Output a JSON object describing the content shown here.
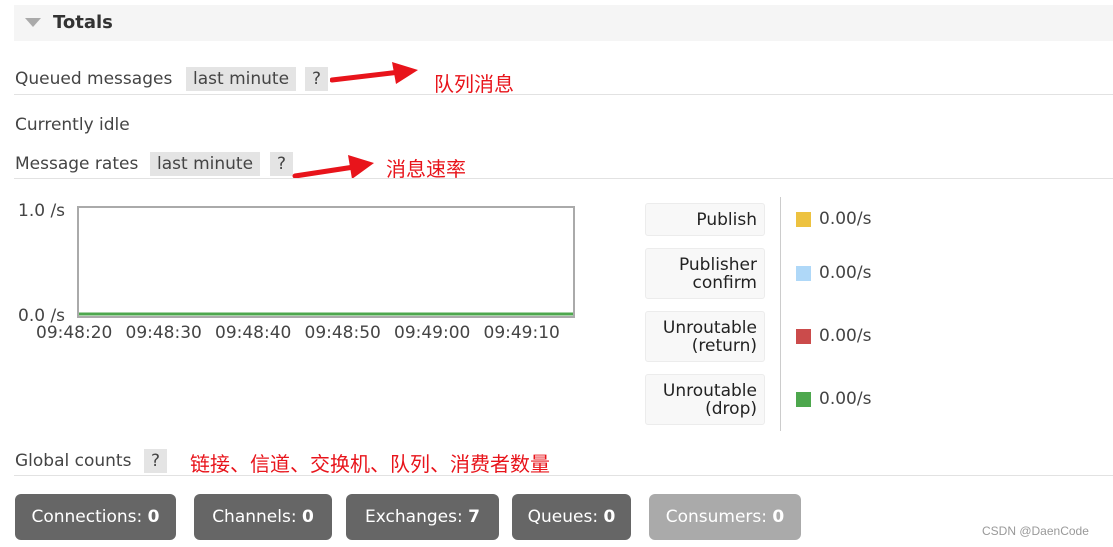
{
  "section": {
    "title": "Totals",
    "expanded": true
  },
  "queued": {
    "label": "Queued messages",
    "range": "last minute",
    "help": "?",
    "annotation": "队列消息",
    "status": "Currently idle"
  },
  "rates": {
    "label": "Message rates",
    "range": "last minute",
    "help": "?",
    "annotation": "消息速率"
  },
  "chart_data": {
    "type": "line",
    "title": "Message rates",
    "xlabel": "",
    "ylabel": "",
    "ylim": [
      0.0,
      1.0
    ],
    "yticks": [
      "1.0 /s",
      "0.0 /s"
    ],
    "x": [
      "09:48:20",
      "09:48:30",
      "09:48:40",
      "09:48:50",
      "09:49:00",
      "09:49:10"
    ],
    "series": [
      {
        "name": "Publish",
        "color": "#edc240",
        "values": [
          0,
          0,
          0,
          0,
          0,
          0
        ]
      },
      {
        "name": "Publisher confirm",
        "color": "#afd8f8",
        "values": [
          0,
          0,
          0,
          0,
          0,
          0
        ]
      },
      {
        "name": "Unroutable (return)",
        "color": "#cb4b4b",
        "values": [
          0,
          0,
          0,
          0,
          0,
          0
        ]
      },
      {
        "name": "Unroutable (drop)",
        "color": "#4da74d",
        "values": [
          0,
          0,
          0,
          0,
          0,
          0
        ]
      }
    ],
    "grid": false,
    "legend": "right"
  },
  "legend": [
    {
      "l1": "Publish",
      "l2": "",
      "rate": "0.00/s",
      "color": "#edc240"
    },
    {
      "l1": "Publisher",
      "l2": "confirm",
      "rate": "0.00/s",
      "color": "#afd8f8"
    },
    {
      "l1": "Unroutable",
      "l2": "(return)",
      "rate": "0.00/s",
      "color": "#cb4b4b"
    },
    {
      "l1": "Unroutable",
      "l2": "(drop)",
      "rate": "0.00/s",
      "color": "#4da74d"
    }
  ],
  "global": {
    "label": "Global counts",
    "help": "?",
    "annotation": "链接、信道、交换机、队列、消费者数量"
  },
  "counts": [
    {
      "label": "Connections:",
      "value": "0"
    },
    {
      "label": "Channels:",
      "value": "0"
    },
    {
      "label": "Exchanges:",
      "value": "7"
    },
    {
      "label": "Queues:",
      "value": "0"
    },
    {
      "label": "Consumers:",
      "value": "0"
    }
  ],
  "watermark": "CSDN @DaenCode"
}
